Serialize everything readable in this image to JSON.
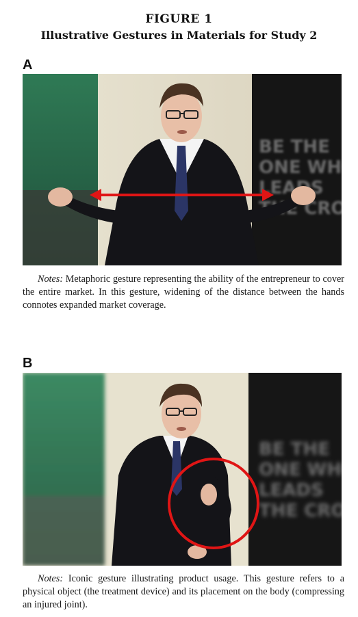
{
  "figure": {
    "label": "FIGURE 1",
    "title": "Illustrative Gestures in Materials for Study 2"
  },
  "panels": [
    {
      "letter": "A",
      "notes_label": "Notes:",
      "notes_text": " Metaphoric gesture representing the ability of the entrepreneur to cover the entire market. In this gesture, widening of the distance between the hands connotes expanded market coverage.",
      "background_text": [
        "BE THE",
        "ONE WHO",
        "LEADS",
        "THE CROW"
      ],
      "annotation": "double-arrow",
      "annotation_color": "#e01515"
    },
    {
      "letter": "B",
      "notes_label": "Notes:",
      "notes_text": " Iconic gesture illustrating product usage. This gesture refers to a physical object (the treatment device) and its placement on the body (compressing an injured joint).",
      "background_text": [
        "BE THE",
        "ONE WHO",
        "LEADS",
        "THE CROW"
      ],
      "annotation": "circle",
      "annotation_color": "#e01515"
    }
  ]
}
